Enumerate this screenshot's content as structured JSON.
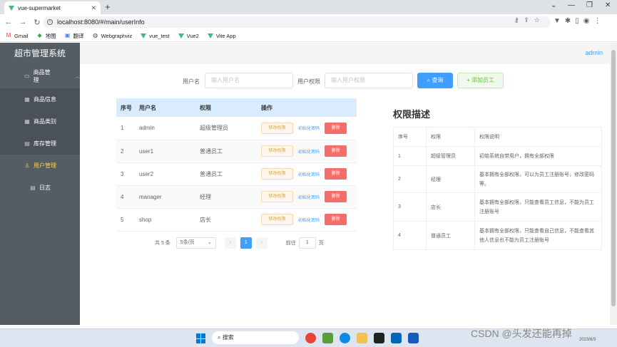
{
  "browser": {
    "tab_title": "vue-supermarket",
    "url": "localhost:8080/#/main/userInfo",
    "bookmarks": [
      "Gmail",
      "地图",
      "翻译",
      "Webgraphviz",
      "vue_test",
      "Vue2",
      "Vite App"
    ]
  },
  "sidebar": {
    "title": "超市管理系统",
    "group_label": "商品管理",
    "items": [
      "商品信息",
      "商品类别",
      "库存管理",
      "用户管理",
      "日志"
    ]
  },
  "header": {
    "user": "admin"
  },
  "search": {
    "username_label": "用户名",
    "username_placeholder": "输入用户名",
    "perm_label": "用户权限",
    "perm_placeholder": "输入用户权限",
    "query_label": "查询",
    "add_label": "添加员工"
  },
  "users": {
    "headers": [
      "序号",
      "用户名",
      "权限",
      "操作"
    ],
    "edit_label": "修改权限",
    "reset_label": "初始化密码",
    "delete_label": "删除",
    "rows": [
      {
        "no": "1",
        "name": "admin",
        "perm": "超级管理员"
      },
      {
        "no": "2",
        "name": "user1",
        "perm": "普通员工"
      },
      {
        "no": "3",
        "name": "user2",
        "perm": "普通员工"
      },
      {
        "no": "4",
        "name": "manager",
        "perm": "经理"
      },
      {
        "no": "5",
        "name": "shop",
        "perm": "店长"
      }
    ]
  },
  "pagination": {
    "total": "共 5 条",
    "page_size": "5条/页",
    "current": "1",
    "goto_prefix": "前往",
    "goto_value": "1",
    "goto_suffix": "页"
  },
  "perms": {
    "title": "权限描述",
    "headers": [
      "序号",
      "权限",
      "权限说明"
    ],
    "rows": [
      {
        "no": "1",
        "perm": "超级管理员",
        "desc": "初始系统自带用户，拥有全部权限"
      },
      {
        "no": "2",
        "perm": "经理",
        "desc": "基本拥有全部权限，可以为员工注册账号，修改密码等。"
      },
      {
        "no": "3",
        "perm": "店长",
        "desc": "基本拥有全部权限，只能查看员工信息，不能为员工注册账号"
      },
      {
        "no": "4",
        "perm": "普通员工",
        "desc": "基本拥有全部权限，只能查看自己信息，不能查看其他人信息也不能为员工注册账号"
      }
    ]
  },
  "taskbar": {
    "search_label": "搜索",
    "watermark": "CSDN @头发还能再掉",
    "date": "2023/6/3"
  }
}
